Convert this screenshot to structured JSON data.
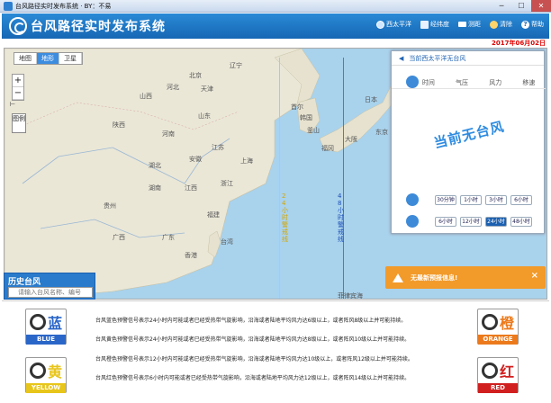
{
  "window": {
    "title": "台风路径实时发布系统 · BY：不易"
  },
  "header": {
    "title": "台风路径实时发布系统"
  },
  "menu": [
    {
      "label": "西太平洋",
      "icon": "globe-icon"
    },
    {
      "label": "经纬度",
      "icon": "grid-icon"
    },
    {
      "label": "测距",
      "icon": "ruler-icon"
    },
    {
      "label": "清除",
      "icon": "broom-icon"
    },
    {
      "label": "帮助",
      "icon": "help-icon"
    }
  ],
  "date": "2017年06月02日",
  "map": {
    "tabs": [
      "地图",
      "地形",
      "卫星"
    ],
    "active_tab": "地形",
    "zoom_in": "+",
    "zoom_out": "−",
    "legend_label": "图例",
    "line24_label": "24小时警戒线",
    "line48_label": "48小时警戒线",
    "places": [
      {
        "name": "辽宁"
      },
      {
        "name": "北京"
      },
      {
        "name": "天津"
      },
      {
        "name": "河北"
      },
      {
        "name": "山西"
      },
      {
        "name": "山东"
      },
      {
        "name": "河南"
      },
      {
        "name": "陕西"
      },
      {
        "name": "江苏"
      },
      {
        "name": "安徽"
      },
      {
        "name": "湖北"
      },
      {
        "name": "上海"
      },
      {
        "name": "浙江"
      },
      {
        "name": "江西"
      },
      {
        "name": "湖南"
      },
      {
        "name": "福建"
      },
      {
        "name": "台湾"
      },
      {
        "name": "广东"
      },
      {
        "name": "广西"
      },
      {
        "name": "贵州"
      },
      {
        "name": "韩国"
      },
      {
        "name": "日本"
      },
      {
        "name": "东京"
      },
      {
        "name": "首尔"
      },
      {
        "name": "香港"
      },
      {
        "name": "菲律宾海"
      },
      {
        "name": "大阪"
      },
      {
        "name": "福冈"
      },
      {
        "name": "釜山"
      }
    ]
  },
  "panel": {
    "title": "当前西太平洋无台风",
    "columns": [
      "时间",
      "气压",
      "风力",
      "移速"
    ],
    "empty_text": "当前无台风",
    "rows": [
      {
        "buttons": [
          "30分钟",
          "1小时",
          "3小时",
          "6小时"
        ],
        "active": "-"
      },
      {
        "buttons": [
          "6小时",
          "12小时",
          "24小时",
          "48小时"
        ],
        "active": "24小时"
      }
    ]
  },
  "toast": {
    "message": "无最新预报信息!",
    "close": "×"
  },
  "history": {
    "title": "历史台风",
    "placeholder": "请输入台风名称、编号"
  },
  "signals": [
    {
      "char": "蓝",
      "label": "BLUE",
      "color": "#2a66c8",
      "text": "台风蓝色预警信号表示24小时内可能或者已经受热带气旋影响，沿海或者陆地平均风力达6级以上，或者阵风8级以上并可能持续。"
    },
    {
      "char": "黄",
      "label": "YELLOW",
      "color": "#e8c51a",
      "text": "台风黄色预警信号表示24小时内可能或者已经受热带气旋影响，沿海或者陆地平均风力达8级以上，或者阵风10级以上并可能持续。"
    },
    {
      "char": "橙",
      "label": "ORANGE",
      "color": "#ec7a1c",
      "text": "台风橙色预警信号表示12小时内可能或者已经受热带气旋影响，沿海或者陆地平均风力达10级以上，或者阵风12级以上并可能持续。"
    },
    {
      "char": "红",
      "label": "RED",
      "color": "#d11f1f",
      "text": "台风红色预警信号表示6小时内可能或者已经受热带气旋影响，沿海或者陆地平均风力达12级以上，或者阵风14级以上并可能持续。"
    }
  ]
}
